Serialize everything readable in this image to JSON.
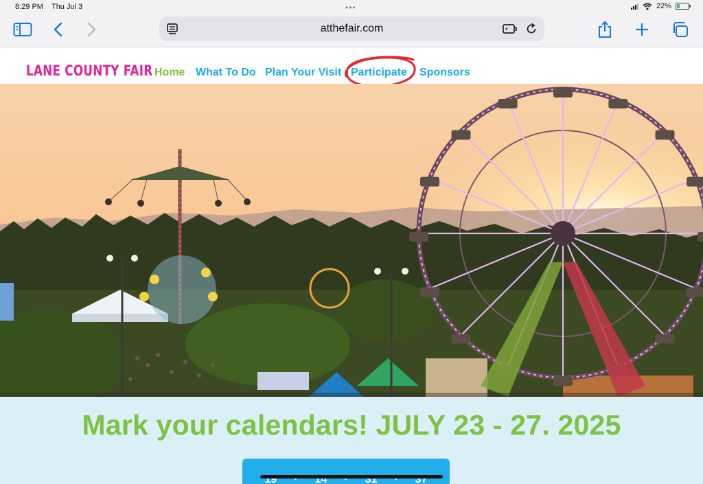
{
  "status_bar": {
    "time": "8:29 PM",
    "date": "Thu Jul 3",
    "battery_percent": "22%",
    "battery_level": 0.22
  },
  "browser": {
    "url": "atthefair.com",
    "icons": [
      "sidebar-icon",
      "back-icon",
      "forward-icon",
      "reader-icon",
      "extension-icon",
      "reload-icon",
      "share-icon",
      "new-tab-icon",
      "tabs-icon"
    ]
  },
  "site": {
    "brand": "LANE COUNTY FAIR",
    "nav": [
      "Home",
      "What To Do",
      "Plan Your Visit",
      "Participate",
      "Sponsors"
    ],
    "colors": {
      "brand": "#e0259a",
      "home": "#7dc242",
      "link": "#1aaee6",
      "annotation": "#e8242e"
    }
  },
  "banner": {
    "title": "Mark your calendars! JULY 23 - 27. 2025",
    "countdown": [
      "19",
      "14",
      "31",
      "37"
    ]
  }
}
